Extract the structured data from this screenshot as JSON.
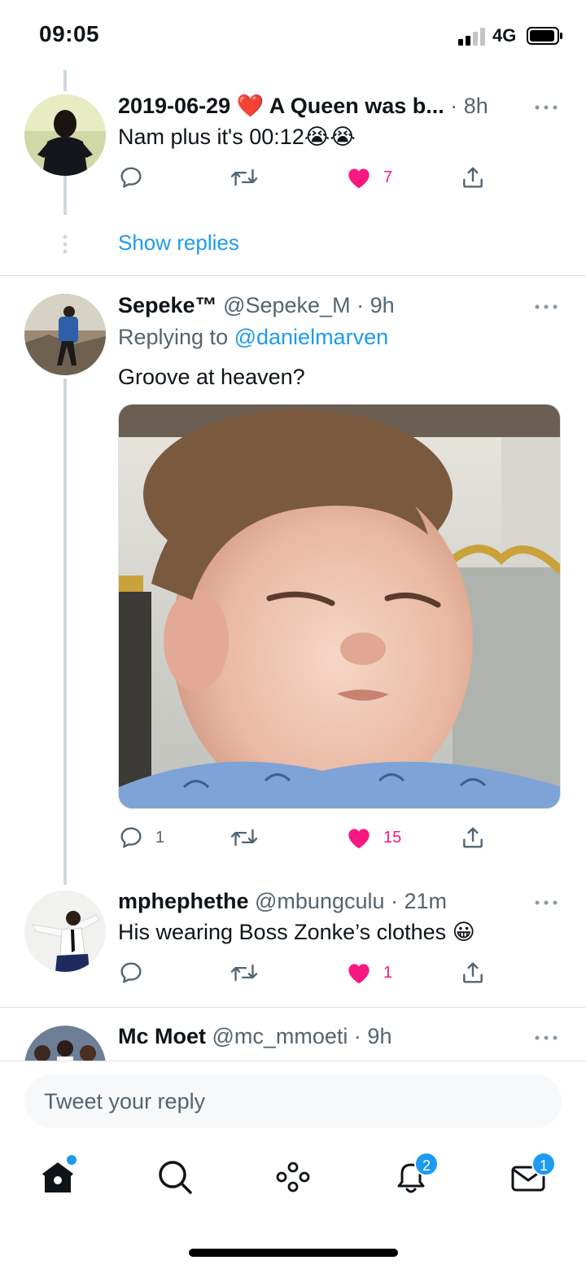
{
  "status_bar": {
    "time": "09:05",
    "network": "4G"
  },
  "tweets": [
    {
      "name": "2019-06-29 ❤️ A Queen was b...",
      "meta": " · 8h",
      "text": "Nam plus it's 00:12😭😭",
      "replies": "",
      "retweets": "",
      "likes": "7",
      "liked": true
    },
    {
      "name": "Sepeke™",
      "meta": " @Sepeke_M · 9h",
      "replying_prefix": "Replying to ",
      "replying_handle": "@danielmarven",
      "text": "Groove at heaven?",
      "replies": "1",
      "retweets": "",
      "likes": "15",
      "liked": true
    },
    {
      "name": "mphephethe",
      "meta": " @mbungculu · 21m",
      "text": "His wearing Boss Zonke’s clothes 😀",
      "replies": "",
      "retweets": "",
      "likes": "1",
      "liked": true
    },
    {
      "name": "Mc Moet",
      "meta": " @mc_mmoeti · 9h"
    }
  ],
  "show_replies": "Show replies",
  "reply_bar": {
    "placeholder": "Tweet your reply"
  },
  "tab_bar": {
    "items": [
      "home-icon",
      "search-icon",
      "spaces-icon",
      "notifications-icon",
      "messages-icon"
    ],
    "notifications_badge": "2",
    "messages_badge": "1"
  },
  "colors": {
    "accent": "#1d9bf0",
    "like": "#f91880",
    "muted": "#536471",
    "divider": "#dde3e7"
  }
}
